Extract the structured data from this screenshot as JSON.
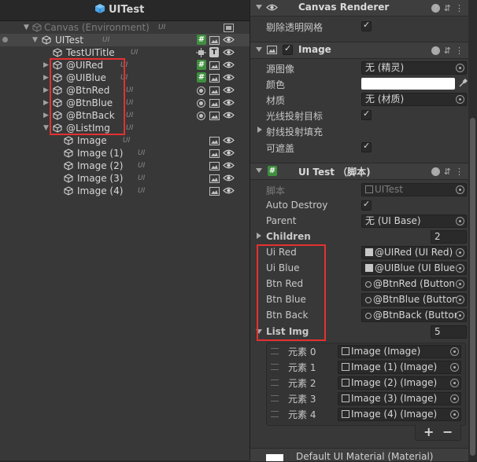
{
  "hierarchy": {
    "title": "UITest",
    "rows": [
      {
        "label": "Canvas (Environment)",
        "tag": "UI"
      },
      {
        "label": "UITest",
        "tag": "UI"
      },
      {
        "label": "TestUITitle",
        "tag": "UI"
      },
      {
        "label": "@UIRed",
        "tag": "UI"
      },
      {
        "label": "@UIBlue",
        "tag": "UI"
      },
      {
        "label": "@BtnRed",
        "tag": "UI"
      },
      {
        "label": "@BtnBlue",
        "tag": "UI"
      },
      {
        "label": "@BtnBack",
        "tag": "UI"
      },
      {
        "label": "@ListImg",
        "tag": "UI"
      },
      {
        "label": "Image",
        "tag": "UI"
      },
      {
        "label": "Image (1)",
        "tag": "UI"
      },
      {
        "label": "Image (2)",
        "tag": "UI"
      },
      {
        "label": "Image (3)",
        "tag": "UI"
      },
      {
        "label": "Image (4)",
        "tag": "UI"
      }
    ],
    "badge_t": "T",
    "badge_hash": "#"
  },
  "inspector": {
    "canvas_renderer": {
      "title": "Canvas Renderer",
      "cull_label": "剔除透明网格"
    },
    "image": {
      "title": "Image",
      "source_label": "源图像",
      "source_value": "无 (精灵)",
      "color_label": "颜色",
      "material_label": "材质",
      "material_value": "无 (材质)",
      "raycast_label": "光线投射目标",
      "raycast_padding_label": "射线投射填充",
      "maskable_label": "可遮盖"
    },
    "uitest": {
      "title": "UI Test （脚本)",
      "script_label": "脚本",
      "script_value": "UITest",
      "auto_destroy_label": "Auto Destroy",
      "parent_label": "Parent",
      "parent_value": "无 (UI Base)",
      "children_label": "Children",
      "children_value": "2",
      "fields": [
        {
          "label": "Ui Red",
          "value": "@UIRed (UI Red)"
        },
        {
          "label": "Ui Blue",
          "value": "@UIBlue (UI Blue"
        },
        {
          "label": "Btn Red",
          "value": "@BtnRed (Button"
        },
        {
          "label": "Btn Blue",
          "value": "@BtnBlue (Button"
        },
        {
          "label": "Btn Back",
          "value": "@BtnBack (Button"
        }
      ],
      "list_label": "List Img",
      "list_count": "5",
      "elements": [
        {
          "label": "元素 0",
          "value": "Image (Image)"
        },
        {
          "label": "元素 1",
          "value": "Image (1) (Image)"
        },
        {
          "label": "元素 2",
          "value": "Image (2) (Image)"
        },
        {
          "label": "元素 3",
          "value": "Image (3) (Image)"
        },
        {
          "label": "元素 4",
          "value": "Image (4) (Image)"
        }
      ],
      "plus": "+",
      "minus": "−"
    },
    "material_footer": "Default UI Material (Material)"
  },
  "colors": {
    "highlight": "#e53030",
    "hash_green": "#3f8f3f"
  }
}
